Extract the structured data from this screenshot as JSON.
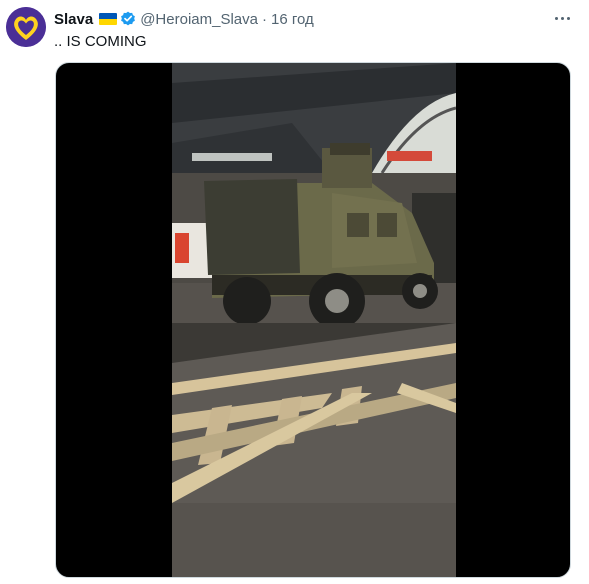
{
  "tweet": {
    "author_name": "Slava",
    "author_flag": "ukraine-flag",
    "verified_icon": "verified-badge-icon",
    "handle": "@Heroiam_Slava",
    "separator": "·",
    "timestamp": "16 год",
    "text": ".. IS COMING",
    "more_icon": "more-options-icon",
    "media": {
      "type": "video",
      "description_icon": "video-thumbnail"
    }
  },
  "colors": {
    "text_primary": "#0f1419",
    "text_secondary": "#536471",
    "verified_blue": "#1d9bf0",
    "flag_blue": "#0057b7",
    "flag_yellow": "#ffd700",
    "avatar_purple": "#5b3fa3",
    "media_bg": "#000000"
  }
}
